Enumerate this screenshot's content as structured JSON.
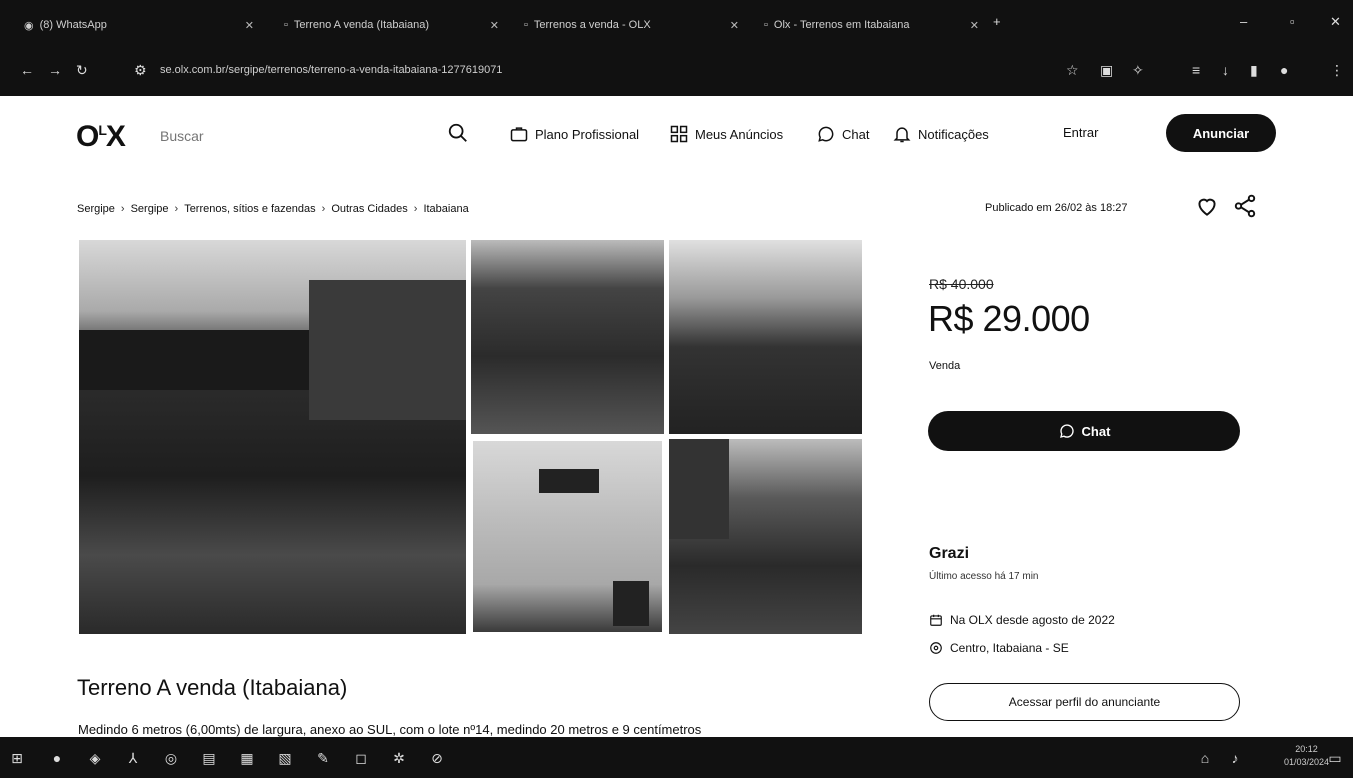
{
  "browser": {
    "tabs": [
      {
        "label": "(8) WhatsApp"
      },
      {
        "label": "Terreno A venda (Itabaiana)"
      },
      {
        "label": "Terrenos a venda - OLX"
      },
      {
        "label": "Olx - Terrenos em Itabaiana"
      }
    ],
    "url": "se.olx.com.br/sergipe/terrenos/terreno-a-venda-itabaiana-1277619071"
  },
  "header": {
    "logo": "OLX",
    "search_placeholder": "Buscar",
    "nav": [
      {
        "label": "Plano Profissional",
        "icon": "briefcase-icon"
      },
      {
        "label": "Meus Anúncios",
        "icon": "grid-icon"
      },
      {
        "label": "Chat",
        "icon": "chat-icon"
      },
      {
        "label": "Notificações",
        "icon": "bell-icon"
      }
    ],
    "login_label": "Entrar",
    "post_label": "Anunciar"
  },
  "breadcrumb": [
    "Sergipe",
    "Sergipe",
    "Terrenos, sítios e fazendas",
    "Outras Cidades",
    "Itabaiana"
  ],
  "published": "Publicado em 26/02 às 18:27",
  "listing": {
    "old_price": "R$ 40.000",
    "price": "R$ 29.000",
    "type": "Venda",
    "chat_label": "Chat",
    "title": "Terreno A venda (Itabaiana)",
    "description": "Medindo 6 metros (6,00mts) de largura, anexo ao SUL, com o lote nº14, medindo 20 metros e 9 centímetros"
  },
  "seller": {
    "name": "Grazi",
    "last_access": "Último acesso há 17 min",
    "member_since": "Na OLX desde agosto de 2022",
    "location": "Centro, Itabaiana - SE",
    "profile_label": "Acessar perfil do anunciante"
  },
  "taskbar": {
    "time": "20:12",
    "date": "01/03/2024"
  },
  "colors": {
    "chrome": "#111111",
    "primary_button": "#111111",
    "background": "#ffffff"
  }
}
